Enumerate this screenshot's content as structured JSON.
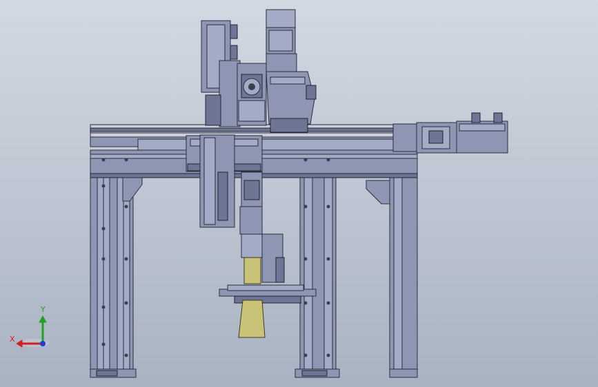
{
  "triad": {
    "x_label": "X",
    "y_label": "Y",
    "x_color": "#d21f1f",
    "y_color": "#1fa31f",
    "z_color": "#1f3fd2"
  },
  "icons": {
    "triad": "coordinate-triad-icon"
  }
}
